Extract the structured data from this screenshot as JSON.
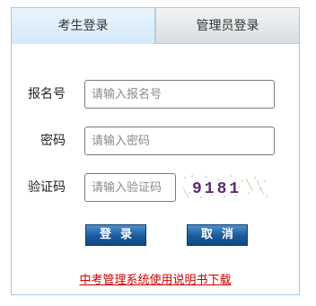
{
  "tabs": {
    "student_login": "考生登录",
    "admin_login": "管理员登录"
  },
  "form": {
    "registration": {
      "label": "报名号",
      "placeholder": "请输入报名号"
    },
    "password": {
      "label": "密码",
      "placeholder": "请输入密码"
    },
    "captcha": {
      "label": "验证码",
      "placeholder": "请输入验证码",
      "code": "9181"
    }
  },
  "buttons": {
    "login": "登录",
    "cancel": "取消"
  },
  "links": {
    "manual": "中考管理系统使用说明书下载"
  },
  "colors": {
    "border": "#a9c7e2",
    "button": "#1a5a9a",
    "link": "#d20000"
  }
}
